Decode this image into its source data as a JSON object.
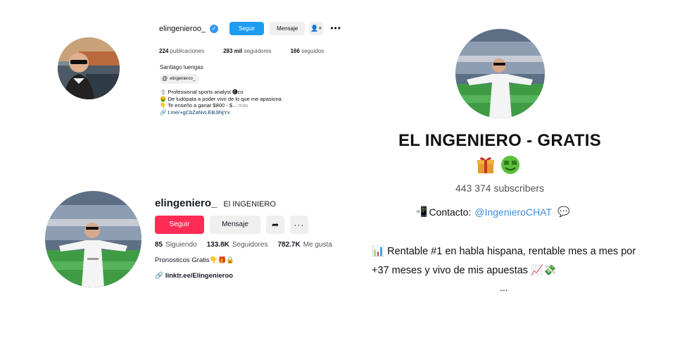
{
  "instagram": {
    "username": "elingenieroo_",
    "follow_label": "Seguir",
    "message_label": "Mensaje",
    "stats": [
      {
        "value": "224",
        "label": "publicaciones"
      },
      {
        "value": "283 mil",
        "label": "seguidores"
      },
      {
        "value": "166",
        "label": "seguidos"
      }
    ],
    "name": "Santiago luengas",
    "threads_handle": "elingenieroo_",
    "bio_lines": [
      "Professional sports analyst",
      "De ludópata a poder vivir de lo que me apasiona",
      "Te enseño a ganar $800 - $..."
    ],
    "bio_more": "más",
    "link": "t.me/+gCbZaNvLEBJiNjYx"
  },
  "tiktok": {
    "username": "elingeniero_",
    "nickname": "El INGENIERO",
    "follow_label": "Seguir",
    "message_label": "Mensaje",
    "stats": [
      {
        "value": "85",
        "label": "Siguiendo"
      },
      {
        "value": "133.8K",
        "label": "Seguidores"
      },
      {
        "value": "782.7K",
        "label": "Me gusta"
      }
    ],
    "bio": "Pronosticos Gratis",
    "link": "linktr.ee/Elingenieroo"
  },
  "telegram": {
    "title": "EL INGENIERO - GRATIS",
    "subscribers": "443 374 subscribers",
    "contact_label": "Contacto:",
    "contact_handle": "@IngenieroCHAT",
    "bio": "Rentable #1 en habla hispana, rentable mes a mes por +37 meses y vivo de mis apuestas",
    "ellipsis": "..."
  },
  "colors": {
    "ig_blue": "#1d9bf0",
    "tiktok_red": "#fe2c55",
    "telegram_link": "#3b8ed6"
  },
  "icons": [
    "verified-badge-icon",
    "add-user-icon",
    "more-icon",
    "threads-icon",
    "link-icon",
    "share-icon",
    "phone-icon",
    "chat-bubble-icon",
    "gift-icon",
    "money-face-icon",
    "chart-icon"
  ]
}
